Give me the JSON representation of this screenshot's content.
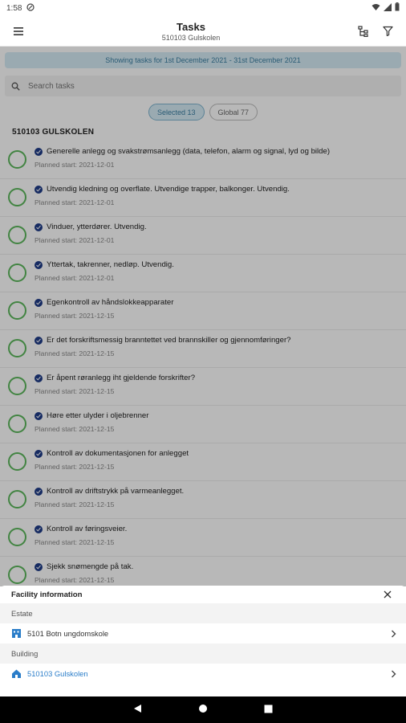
{
  "status_bar": {
    "time": "1:58"
  },
  "app_bar": {
    "title": "Tasks",
    "subtitle": "510103 Gulskolen"
  },
  "banner": {
    "text": "Showing tasks for 1st December 2021 - 31st December 2021"
  },
  "search": {
    "placeholder": "Search tasks"
  },
  "chips": [
    {
      "label": "Selected 13",
      "selected": true
    },
    {
      "label": "Global 77",
      "selected": false
    }
  ],
  "section": {
    "title": "510103 GULSKOLEN"
  },
  "tasks": [
    {
      "title": "Generelle anlegg og  svakstrømsanlegg (data, telefon, alarm og signal, lyd og bilde)",
      "planned": "Planned start: 2021-12-01"
    },
    {
      "title": "Utvendig kledning og overflate. Utvendige trapper, balkonger. Utvendig.",
      "planned": "Planned start: 2021-12-01"
    },
    {
      "title": "Vinduer, ytterdører. Utvendig.",
      "planned": "Planned start: 2021-12-01"
    },
    {
      "title": "Yttertak, takrenner, nedløp. Utvendig.",
      "planned": "Planned start: 2021-12-01"
    },
    {
      "title": "Egenkontroll av håndslokkeapparater",
      "planned": "Planned start: 2021-12-15"
    },
    {
      "title": "Er det forskriftsmessig branntettet ved brannskiller og gjennomføringer?",
      "planned": "Planned start: 2021-12-15"
    },
    {
      "title": "Er åpent røranlegg iht gjeldende forskrifter?",
      "planned": "Planned start: 2021-12-15"
    },
    {
      "title": "Høre etter ulyder i oljebrenner",
      "planned": "Planned start: 2021-12-15"
    },
    {
      "title": "Kontroll av dokumentasjonen for anlegget",
      "planned": "Planned start: 2021-12-15"
    },
    {
      "title": "Kontroll av driftstrykk på varmeanlegget.",
      "planned": "Planned start: 2021-12-15"
    },
    {
      "title": "Kontroll av føringsveier.",
      "planned": "Planned start: 2021-12-15"
    },
    {
      "title": "Sjekk snømengde på tak.",
      "planned": "Planned start: 2021-12-15"
    }
  ],
  "sheet": {
    "title": "Facility information",
    "estate_label": "Estate",
    "estate_name": "5101 Botn ungdomskole",
    "building_label": "Building",
    "building_name": "510103 Gulskolen"
  },
  "colors": {
    "accent": "#2a7dc9",
    "banner_bg": "#d6ecf5",
    "task_circle": "#5cb85c",
    "status_icon": "#1f3c88"
  }
}
